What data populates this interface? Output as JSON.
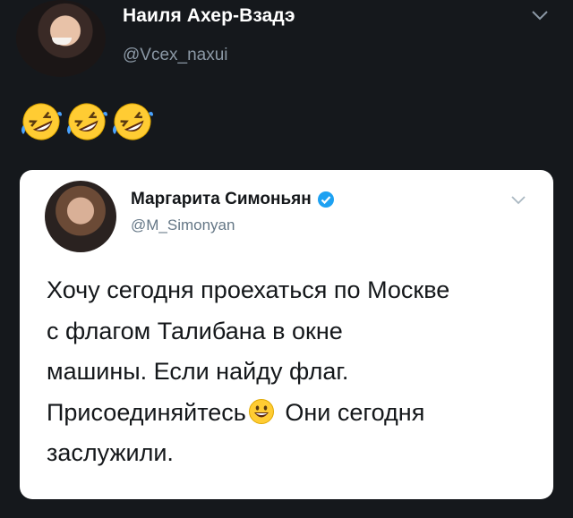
{
  "outer_tweet": {
    "author_name": "Наиля Ахер-Взадэ",
    "author_handle": "@Vcex_naxui",
    "body_emoji": [
      "rolling-on-floor-laughing",
      "rolling-on-floor-laughing",
      "rolling-on-floor-laughing"
    ]
  },
  "quoted_tweet": {
    "author_name": "Маргарита Симоньян",
    "author_handle": "@M_Simonyan",
    "verified": true,
    "text_lines": [
      "Хочу сегодня проехаться по Москве",
      "с флагом Талибана в окне",
      "машины. Если найду флаг.",
      "Присоединяйтесь",
      " Они сегодня",
      "заслужили."
    ],
    "inline_emoji": "grinning-face"
  },
  "colors": {
    "page_background": "#15181c",
    "card_background": "#ffffff",
    "name_text_dark": "#ffffff",
    "handle_text_dark": "#8b98a5",
    "verified_blue": "#1da1f2",
    "body_text": "#14171a",
    "handle_text_light": "#657786"
  }
}
